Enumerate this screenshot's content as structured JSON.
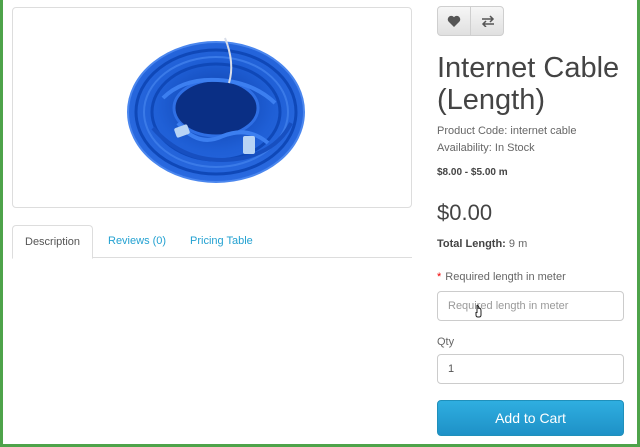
{
  "product": {
    "title_line1": "Internet Cable",
    "title_line2": "(Length)",
    "code_label": "Product Code:",
    "code_value": "internet cable",
    "availability_label": "Availability:",
    "availability_value": "In Stock",
    "price_range": "$8.00 - $5.00 m",
    "price": "$0.00",
    "total_length_label": "Total Length:",
    "total_length_value": "9 m",
    "image_icon": "blue-ethernet-cable-coil"
  },
  "actions": {
    "wishlist_icon": "heart-icon",
    "compare_icon": "compare-arrows-icon",
    "add_to_cart_label": "Add to Cart"
  },
  "options": {
    "required_star": "*",
    "length_label": "Required length in meter",
    "length_placeholder": "Required length in meter",
    "length_value": "",
    "qty_label": "Qty",
    "qty_value": "1"
  },
  "tabs": [
    {
      "label": "Description",
      "active": true
    },
    {
      "label": "Reviews (0)",
      "active": false
    },
    {
      "label": "Pricing Table",
      "active": false
    }
  ],
  "colors": {
    "accent_link": "#23a1d1",
    "cart_button": "#229ccf",
    "required_star": "#f00000",
    "frame_border": "#4ea34a",
    "cable_blue": "#1f5fd6"
  }
}
